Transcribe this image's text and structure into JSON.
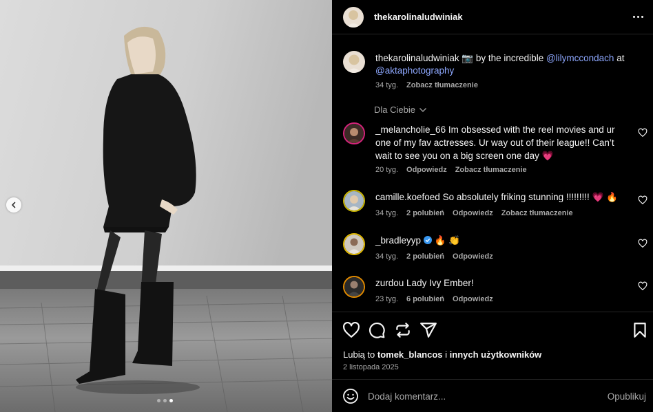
{
  "post": {
    "carousel": {
      "slide_count": 3,
      "active_index": 2
    }
  },
  "header": {
    "username": "thekarolinaludwiniak"
  },
  "caption": {
    "username": "thekarolinaludwiniak",
    "text_before": " 📷 by the incredible ",
    "mention1": "@lilymccondach",
    "text_middle": " at ",
    "mention2": "@aktaphotography",
    "time": "34 tyg.",
    "translate": "Zobacz tłumaczenie"
  },
  "filter": {
    "label": "Dla Ciebie"
  },
  "comments": [
    {
      "username": "_melancholie_66",
      "text": "Im obsessed with the reel movies and ur one of my fav actresses. Ur way out of their league!! Can’t wait to see you on a big screen one day 💗",
      "time": "20 tyg.",
      "likes": "",
      "reply": "Odpowiedz",
      "translate": "Zobacz tłumaczenie",
      "ring_color": "#d6247c"
    },
    {
      "username": "camille.koefoed",
      "text": "So absolutely friking stunning !!!!!!!!! 💗 🔥",
      "time": "34 tyg.",
      "likes": "2 polubień",
      "reply": "Odpowiedz",
      "translate": "Zobacz tłumaczenie",
      "ring_color": "#c8b400"
    },
    {
      "username": "_bradleyyp",
      "text": "🔥 👏",
      "time": "34 tyg.",
      "likes": "2 polubień",
      "reply": "Odpowiedz",
      "translate": "",
      "ring_color": "#e0b800",
      "verified": true
    },
    {
      "username": "zurdou",
      "text": "Lady Ivy Ember!",
      "time": "23 tyg.",
      "likes": "6 polubień",
      "reply": "Odpowiedz",
      "translate": "",
      "ring_color": "#e08a00"
    }
  ],
  "actions": {
    "icons": [
      "heart-icon",
      "comment-icon",
      "share-icon",
      "send-icon",
      "bookmark-icon"
    ]
  },
  "likes": {
    "prefix": "Lubią to ",
    "user": "tomek_blancos",
    "middle": " i ",
    "others": "innych użytkowników"
  },
  "date": "2 listopada 2025",
  "composer": {
    "placeholder": "Dodaj komentarz...",
    "publish": "Opublikuj"
  },
  "colors": {
    "background": "#000000",
    "text": "#f5f5f5",
    "muted": "#a8a8a8",
    "link": "#8ea8ff",
    "heart_emoji": "#ff3b8d"
  }
}
